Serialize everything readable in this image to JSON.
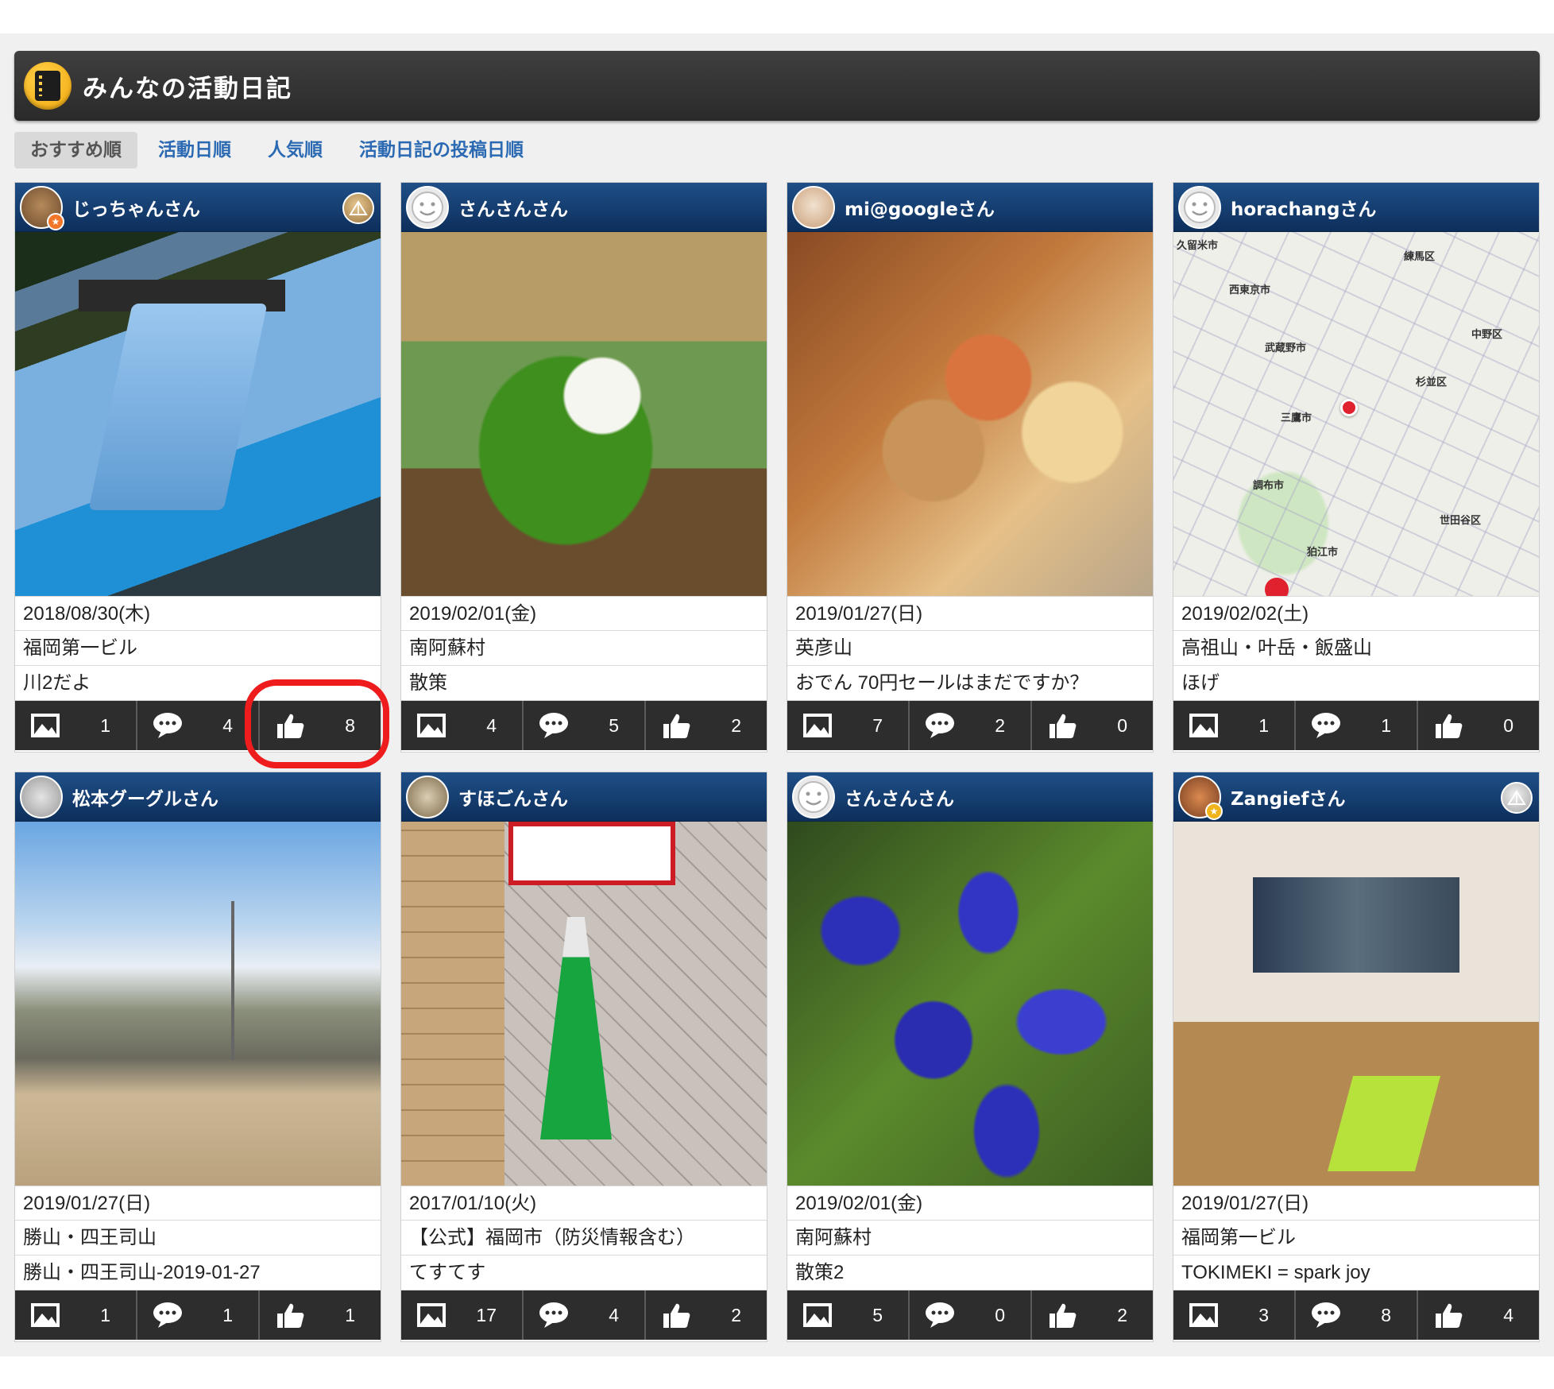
{
  "header": {
    "title": "みんなの活動日記"
  },
  "sort_tabs": [
    {
      "label": "おすすめ順",
      "active": true
    },
    {
      "label": "活動日順",
      "active": false
    },
    {
      "label": "人気順",
      "active": false
    },
    {
      "label": "活動日記の投稿日順",
      "active": false
    }
  ],
  "icons": {
    "photo": "photo-icon",
    "comment": "comment-bubble-icon",
    "like": "thumbs-up-icon"
  },
  "colors": {
    "card_header": "#1a4478",
    "stats_bar": "#2d2d2d",
    "highlight": "#ee1c1c",
    "tab_link": "#2b6ab3"
  },
  "cards": [
    {
      "user": "じっちゃんさん",
      "date": "2018/08/30(木)",
      "location": "福岡第一ビル",
      "title": "川2だよ",
      "photos": "1",
      "comments": "4",
      "likes": "8"
    },
    {
      "user": "さんさんさん",
      "date": "2019/02/01(金)",
      "location": "南阿蘇村",
      "title": "散策",
      "photos": "4",
      "comments": "5",
      "likes": "2"
    },
    {
      "user": "mi@googleさん",
      "date": "2019/01/27(日)",
      "location": "英彦山",
      "title": "おでん 70円セールはまだですか？",
      "photos": "7",
      "comments": "2",
      "likes": "0"
    },
    {
      "user": "horachangさん",
      "date": "2019/02/02(土)",
      "location": "高祖山・叶岳・飯盛山",
      "title": "ほげ",
      "photos": "1",
      "comments": "1",
      "likes": "0",
      "map_labels": [
        "久留米市",
        "練馬区",
        "西東京市",
        "中野区",
        "武蔵野市",
        "杉並区",
        "三鷹市",
        "調布市",
        "世田谷区",
        "狛江市"
      ]
    },
    {
      "user": "松本グーグルさん",
      "date": "2019/01/27(日)",
      "location": "勝山・四王司山",
      "title": "勝山・四王司山-2019-01-27",
      "photos": "1",
      "comments": "1",
      "likes": "1"
    },
    {
      "user": "すほごんさん",
      "date": "2017/01/10(火)",
      "location": "【公式】福岡市（防災情報含む）",
      "title": "てすてす",
      "photos": "17",
      "comments": "4",
      "likes": "2"
    },
    {
      "user": "さんさんさん",
      "date": "2019/02/01(金)",
      "location": "南阿蘇村",
      "title": "散策2",
      "photos": "5",
      "comments": "0",
      "likes": "2"
    },
    {
      "user": "Zangiefさん",
      "date": "2019/01/27(日)",
      "location": "福岡第一ビル",
      "title": "TOKIMEKI = spark joy",
      "photos": "3",
      "comments": "8",
      "likes": "4"
    }
  ]
}
